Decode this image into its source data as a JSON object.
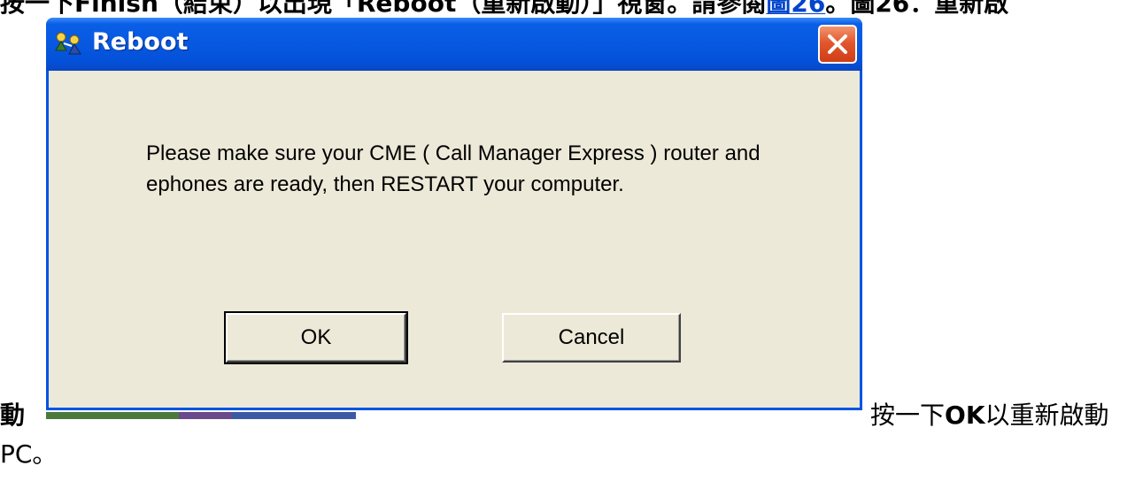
{
  "page": {
    "top_line_prefix": "按一下",
    "top_line_bold": "Finish",
    "top_line_middle": "（結束）以出現「Reboot（重新啟動）」視窗。請參閱",
    "top_line_link": "圖26",
    "top_line_suffix": "。圖26：重新啟",
    "left_char": "動",
    "right_prefix": "按一下",
    "right_bold": "OK",
    "right_suffix": "以重新啟動",
    "bottom_line": "PC。"
  },
  "dialog": {
    "title": "Reboot",
    "title_icon": "network-people-icon",
    "close_icon": "close-icon",
    "message": "Please make sure your CME ( Call Manager Express ) router and ephones are ready, then RESTART your computer.",
    "ok_label": "OK",
    "cancel_label": "Cancel"
  },
  "colors": {
    "titlebar": "#0758e0",
    "dialog_bg": "#ece9d8",
    "close_button": "#e2572e",
    "link": "#0044cc"
  }
}
